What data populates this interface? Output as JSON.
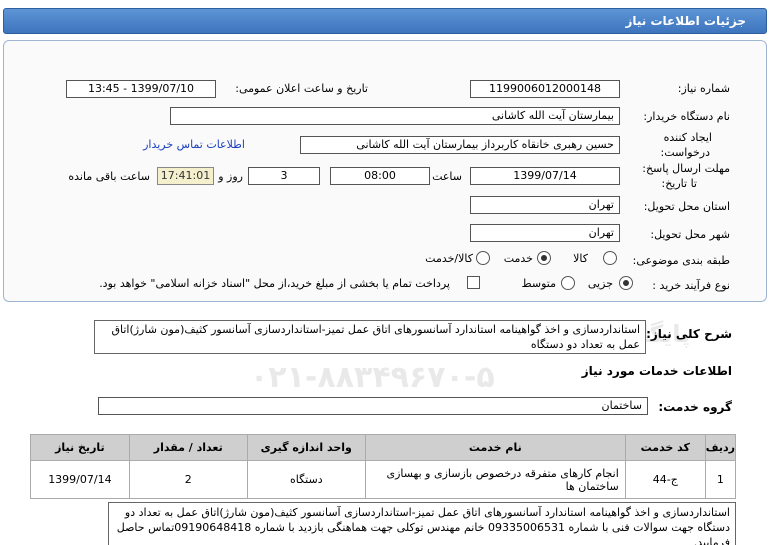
{
  "header": {
    "title": "جزئیات اطلاعات نیاز"
  },
  "form": {
    "need_number_label": "شماره نیاز:",
    "need_number": "1199006012000148",
    "announce_label": "تاریخ و ساعت اعلان عمومی:",
    "announce_value": "1399/07/10 - 13:45",
    "buyer_label": "نام دستگاه خریدار:",
    "buyer_value": "بیمارستان آیت الله کاشانی",
    "creator_label_1": "ایجاد کننده",
    "creator_label_2": "درخواست:",
    "creator_value": "حسین رهبری خانقاه کاربرداز بیمارستان آیت الله کاشانی",
    "contact_link": "اطلاعات تماس خریدار",
    "deadline_label_1": "مهلت ارسال پاسخ:",
    "deadline_label_2": "تا تاریخ:",
    "deadline_date": "1399/07/14",
    "time_label": "ساعت",
    "deadline_time": "08:00",
    "days_value": "3",
    "days_label": "روز و",
    "remaining_time": "17:41:01",
    "remaining_label": "ساعت باقی مانده",
    "province_label": "استان محل تحویل:",
    "province_value": "تهران",
    "city_label": "شهر محل تحویل:",
    "city_value": "تهران",
    "category_label": "طبقه بندی موضوعی:",
    "category_options": [
      "کالا",
      "خدمت",
      "کالا/خدمت"
    ],
    "category_selected": "خدمت",
    "purchase_label": "نوع فرآیند خرید :",
    "purchase_options": [
      "جزیی",
      "متوسط"
    ],
    "purchase_selected": "جزیی",
    "payment_note": "پرداخت تمام یا بخشی از مبلغ خرید،از محل \"اسناد خزانه اسلامی\" خواهد بود."
  },
  "summary": {
    "label": "شرح کلی نیاز:",
    "text": "استانداردسازی و اخذ گواهینامه استاندارد آسانسورهای اتاق عمل تمیز-استانداردسازی آسانسور کثیف(مون شارژ)اتاق عمل به تعداد دو دستگاه"
  },
  "services": {
    "section_title": "اطلاعات خدمات مورد نیاز",
    "group_label": "گروه خدمت:",
    "group_value": "ساختمان",
    "columns": [
      "ردیف",
      "کد خدمت",
      "نام خدمت",
      "واحد اندازه گیری",
      "تعداد / مقدار",
      "تاریخ نیاز"
    ],
    "rows": [
      {
        "index": "1",
        "code": "ج-44",
        "name": "انجام کارهای متفرقه درخصوص بازسازی و بهسازی ساختمان ها",
        "unit": "دستگاه",
        "qty": "2",
        "date": "1399/07/14"
      }
    ]
  },
  "buyer_notes": {
    "text": "استانداردسازی و اخذ گواهینامه استاندارد آسانسورهای اتاق عمل تمیز-استانداردسازی آسانسور کثیف(مون شارژ)اتاق عمل به تعداد دو دستگاه جهت سوالات فنی با شماره 09335006531 خانم مهندس توکلی جهت هماهنگی بازدید با شماره 09190648418تماس حاصل فرمایید."
  },
  "watermark": {
    "line1": "ParsNamadData",
    "line2": "پایگاه اطلاع رسانی مناقصه ومزایده",
    "line3": "۰۲۱-۸۸۳۴۹۶۷۰-۵"
  },
  "colors": {
    "header": "#4a82c8",
    "link": "#1a3fbf",
    "remaining_bg": "#f4efcc"
  }
}
